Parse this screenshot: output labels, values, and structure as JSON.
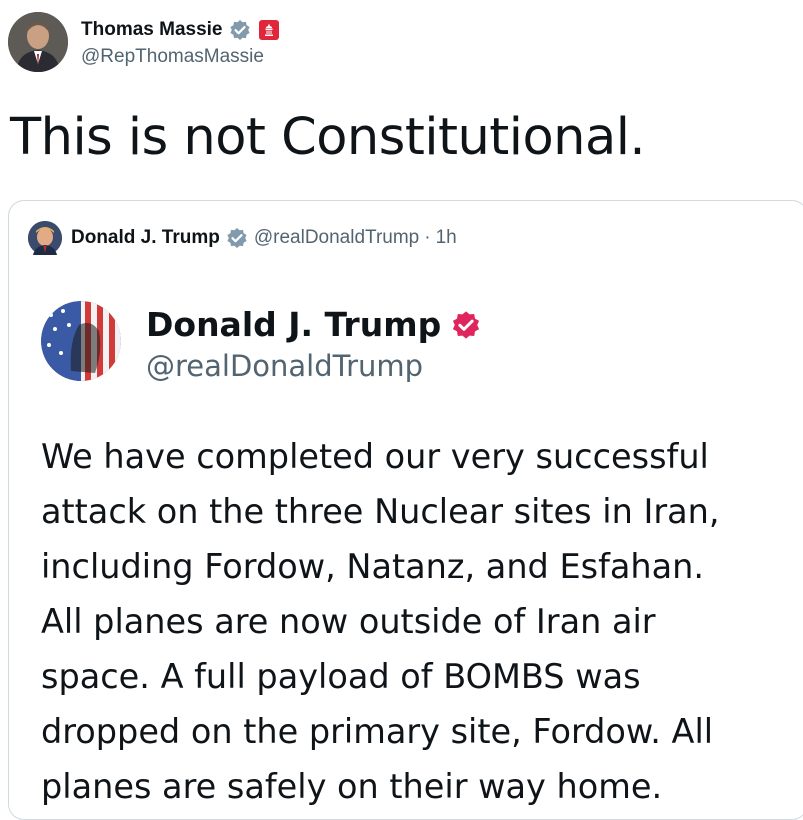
{
  "author": {
    "display_name": "Thomas Massie",
    "handle": "@RepThomasMassie",
    "verified_icon": "verified-badge-icon",
    "affiliation_icon": "congress-badge-icon",
    "colors": {
      "verified": "#829aab",
      "affiliation": "#e0263a"
    }
  },
  "tweet": {
    "text": "This is not Constitutional."
  },
  "quote": {
    "display_name": "Donald J. Trump",
    "handle": "@realDonaldTrump",
    "separator": "·",
    "time": "1h",
    "embed": {
      "display_name": "Donald J. Trump",
      "handle": "@realDonaldTrump",
      "verified_color": "#e0245e",
      "body_lines": [
        "We have completed our very successful",
        "attack on the three Nuclear sites in Iran,",
        "including Fordow, Natanz, and Esfahan.",
        "All planes are now outside of Iran air",
        "space. A full payload of BOMBS was",
        "dropped on the primary site, Fordow. All",
        "planes are safely on their way home."
      ]
    }
  }
}
